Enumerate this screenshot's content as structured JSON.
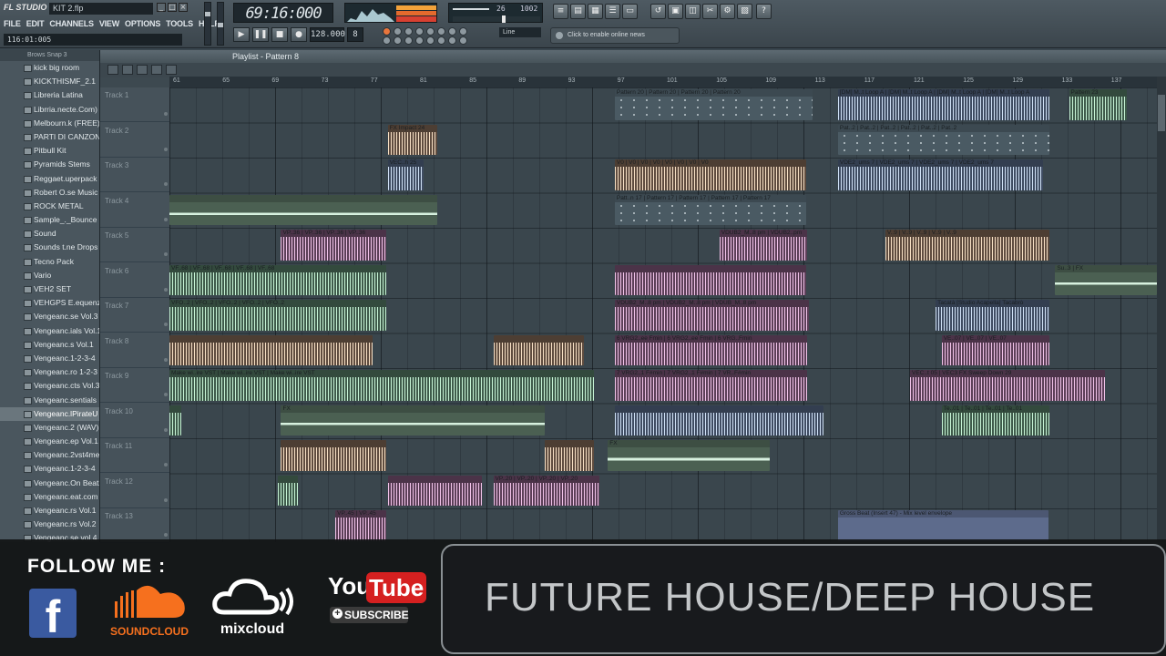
{
  "app": {
    "logo": "FL STUDIO",
    "project": "KIT 2.flp",
    "menu": [
      "FILE",
      "EDIT",
      "CHANNELS",
      "VIEW",
      "OPTIONS",
      "TOOLS",
      "HELP"
    ],
    "hint": "116:01:005",
    "time": "69:16:000",
    "cpu_text": "26",
    "mem_text": "1002",
    "tempo": "128.000",
    "pattern_num": "8",
    "snap": "Line",
    "news": "Click to enable online news"
  },
  "browser": {
    "header": "Brows   Snap 3",
    "items": [
      "kick big room",
      "KICKTHISMF_2.1",
      "Libreria Latina",
      "Librria.necte.Com)",
      "Melbourn.k (FREE)",
      "PARTI DI CANZONI",
      "Pitbull Kit",
      "Pyramids Stems",
      "Reggaet.uperpack",
      "Robert O.se Music",
      "ROCK METAL",
      "Sample_._Bounce",
      "Sound",
      "Sounds t.ne Drops",
      "Tecno Pack",
      "Vario",
      "VEH2 SET",
      "VEHGPS E.equenz",
      "Vengeanc.se Vol.3",
      "Vengeanc.ials Vol.1",
      "Vengeanc.s Vol.1",
      "Vengeanc.1-2-3-4",
      "Vengeanc.ro 1-2-3",
      "Vengeanc.cts Vol.3",
      "Vengeanc.sentials",
      "Vengeanc.lPirateU",
      "Vengeanc.2 (WAV)",
      "Vengeanc.ep Vol.1",
      "Vengeanc.2vst4me",
      "Vengeanc.1-2-3-4",
      "Vengeanc.On Beatz",
      "Vengeanc.eat.com",
      "Vengeanc.rs Vol.1",
      "Vengeanc.rs Vol.2",
      "Vengeanc.se vol.4"
    ],
    "selected_index": 25
  },
  "playlist": {
    "title": "Playlist - Pattern 8",
    "ruler": [
      "61",
      "65",
      "69",
      "73",
      "77",
      "81",
      "85",
      "89",
      "93",
      "97",
      "101",
      "105",
      "109",
      "113",
      "117",
      "121",
      "125",
      "129",
      "133",
      "137"
    ],
    "tracks": [
      "Track 1",
      "Track 2",
      "Track 3",
      "Track 4",
      "Track 5",
      "Track 6",
      "Track 7",
      "Track 8",
      "Track 9",
      "Track 10",
      "Track 11",
      "Track 12",
      "Track 13"
    ],
    "clips": [
      {
        "track": 1,
        "start": 0.451,
        "end": 0.651,
        "color": "pat",
        "label": "Pattern 20 | Pattern 20 | Pattern 20 | Pattern 20"
      },
      {
        "track": 1,
        "start": 0.677,
        "end": 0.891,
        "color": "blue",
        "label": "[DM] M..t Loop A | [DM] M..t Loop A | [DM] M..t Loop A | [DM] M..t Loop A"
      },
      {
        "track": 1,
        "start": 0.911,
        "end": 0.97,
        "color": "green",
        "label": "Pattern 23"
      },
      {
        "track": 2,
        "start": 0.221,
        "end": 0.271,
        "color": "peach",
        "label": "FX Impact 24"
      },
      {
        "track": 2,
        "start": 0.677,
        "end": 0.891,
        "color": "pat",
        "label": "Pat..2 | Pat..2 | Pat..2 | Pat..2 | Pat..2 | Pat..2"
      },
      {
        "track": 3,
        "start": 0.221,
        "end": 0.257,
        "color": "blue",
        "label": "VEC..h 25"
      },
      {
        "track": 3,
        "start": 0.451,
        "end": 0.645,
        "color": "peach",
        "label": "V0 | V0 | V0 | V0 | V0 | V0 | V0 | V0"
      },
      {
        "track": 3,
        "start": 0.677,
        "end": 0.885,
        "color": "blue",
        "label": "VDE2_ums 7 | VDE2_ums 7 | VDE2_ums 7 | VDE2_ums 7"
      },
      {
        "track": 4,
        "start": 0.0,
        "end": 0.271,
        "color": "auto",
        "label": ""
      },
      {
        "track": 4,
        "start": 0.451,
        "end": 0.645,
        "color": "pat",
        "label": "Patt..n 17 | Pattern 17 | Pattern 17 | Pattern 17 | Pattern 17"
      },
      {
        "track": 5,
        "start": 0.113,
        "end": 0.22,
        "color": "pink",
        "label": "VP..36 | VP..36 | VP..36 | VP..36"
      },
      {
        "track": 5,
        "start": 0.557,
        "end": 0.646,
        "color": "pink",
        "label": "VDUB2_M..8 pm | VDUB2..pm"
      },
      {
        "track": 5,
        "start": 0.725,
        "end": 0.891,
        "color": "peach",
        "label": "V..9 | V..9 | V..9 | V..9 | V..9"
      },
      {
        "track": 6,
        "start": 0.0,
        "end": 0.22,
        "color": "green",
        "label": "VF..68 | VF..68 | VF..68 | VF..68 | VF..68"
      },
      {
        "track": 6,
        "start": 0.451,
        "end": 0.645,
        "color": "pink",
        "label": ""
      },
      {
        "track": 6,
        "start": 0.897,
        "end": 1.0,
        "color": "auto",
        "label": "Su..3 | FX"
      },
      {
        "track": 7,
        "start": 0.0,
        "end": 0.22,
        "color": "green",
        "label": "VFO..2 | VFO..2 | VFO..2 | VFO..2 | VFO..2"
      },
      {
        "track": 7,
        "start": 0.451,
        "end": 0.648,
        "color": "pink",
        "label": "VDUB2_M..8 pm | VDUB2_M..8 pm | VDUB_M..8 pm"
      },
      {
        "track": 7,
        "start": 0.776,
        "end": 0.891,
        "color": "blue",
        "label": "Tacatà [Studio Acapella] Tacabrò"
      },
      {
        "track": 8,
        "start": 0.0,
        "end": 0.206,
        "color": "peach",
        "label": ""
      },
      {
        "track": 8,
        "start": 0.328,
        "end": 0.42,
        "color": "peach",
        "label": ""
      },
      {
        "track": 8,
        "start": 0.451,
        "end": 0.646,
        "color": "pink",
        "label": "6 VRG2..ee Fmin | 6 VRG2..ee Fmin | 6 VRG..Fmin"
      },
      {
        "track": 8,
        "start": 0.782,
        "end": 0.891,
        "color": "pink",
        "label": "VE..07 | VE..07 | VE..07"
      },
      {
        "track": 9,
        "start": 0.0,
        "end": 0.43,
        "color": "green",
        "label": "Make wi..ire VST | Make wi..ire VST | Make wi..ire VST"
      },
      {
        "track": 9,
        "start": 0.451,
        "end": 0.646,
        "color": "pink",
        "label": "7 VRG2..1 F#min | 7 VRG2..1 F#min | 7 VR..F#min"
      },
      {
        "track": 9,
        "start": 0.75,
        "end": 0.947,
        "color": "pink",
        "label": "VEC..t 05 | VEC3 FX Sweep Down 29"
      },
      {
        "track": 10,
        "start": 0.0,
        "end": 0.012,
        "color": "green",
        "label": ""
      },
      {
        "track": 10,
        "start": 0.113,
        "end": 0.38,
        "color": "auto",
        "label": "FX"
      },
      {
        "track": 10,
        "start": 0.451,
        "end": 0.662,
        "color": "blue",
        "label": ""
      },
      {
        "track": 10,
        "start": 0.782,
        "end": 0.891,
        "color": "green",
        "label": "Te..01 | Te..01 | Te..01 | Te..01"
      },
      {
        "track": 11,
        "start": 0.113,
        "end": 0.22,
        "color": "peach",
        "label": ""
      },
      {
        "track": 11,
        "start": 0.38,
        "end": 0.43,
        "color": "peach",
        "label": ""
      },
      {
        "track": 11,
        "start": 0.444,
        "end": 0.608,
        "color": "auto",
        "label": "FX"
      },
      {
        "track": 12,
        "start": 0.11,
        "end": 0.13,
        "color": "green",
        "label": ""
      },
      {
        "track": 12,
        "start": 0.221,
        "end": 0.316,
        "color": "pink",
        "label": ""
      },
      {
        "track": 12,
        "start": 0.328,
        "end": 0.435,
        "color": "pink",
        "label": "VP..20 | VP..20 | VP..20 | VP..20"
      },
      {
        "track": 13,
        "start": 0.168,
        "end": 0.22,
        "color": "pink",
        "label": "VP..45 | VP..45"
      },
      {
        "track": 13,
        "start": 0.677,
        "end": 0.89,
        "color": "gross",
        "label": "Gross Beat (Insert 47) - Mix level envelope"
      }
    ]
  },
  "overlay": {
    "follow": "FOLLOW ME :",
    "facebook": "f",
    "soundcloud": "SOUNDCLOUD",
    "mixcloud": "mixcloud",
    "youtube_you": "You",
    "youtube_tube": "Tube",
    "subscribe": "SUBSCRIBE",
    "genre": "FUTURE HOUSE/DEEP HOUSE"
  }
}
